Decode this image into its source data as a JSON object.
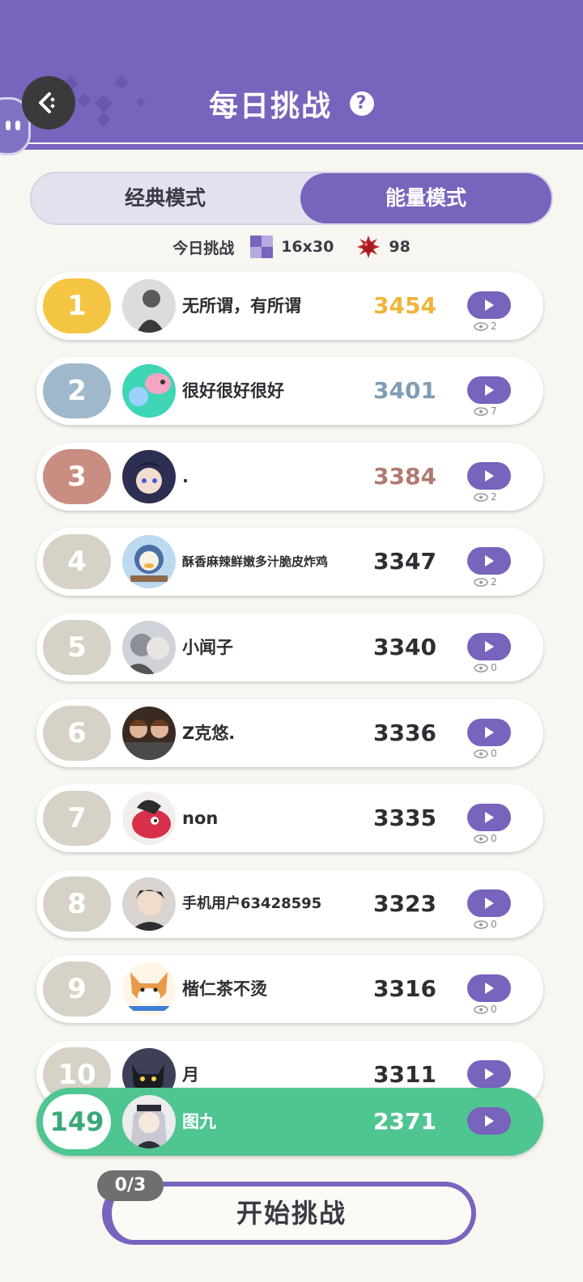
{
  "header": {
    "title": "每日挑战",
    "back_icon": "back-arrow-icon",
    "help_icon": "question-icon"
  },
  "modes": {
    "classic": "经典模式",
    "energy": "能量模式",
    "active": "energy"
  },
  "today": {
    "label": "今日挑战",
    "size": "16x30",
    "mines": "98"
  },
  "leaderboard": [
    {
      "rank": "1",
      "name": "无所谓，有所谓",
      "score": "3454",
      "views": "2"
    },
    {
      "rank": "2",
      "name": "很好很好很好",
      "score": "3401",
      "views": "7"
    },
    {
      "rank": "3",
      "name": ".",
      "score": "3384",
      "views": "2"
    },
    {
      "rank": "4",
      "name": "酥香麻辣鲜嫩多汁脆皮炸鸡",
      "score": "3347",
      "views": "2"
    },
    {
      "rank": "5",
      "name": "小闻子",
      "score": "3340",
      "views": "0"
    },
    {
      "rank": "6",
      "name": "Z克悠.",
      "score": "3336",
      "views": "0"
    },
    {
      "rank": "7",
      "name": "non",
      "score": "3335",
      "views": "0"
    },
    {
      "rank": "8",
      "name": "手机用户63428595",
      "score": "3323",
      "views": "0"
    },
    {
      "rank": "9",
      "name": "楷仁茶不烫",
      "score": "3316",
      "views": "0"
    },
    {
      "rank": "10",
      "name": "月",
      "score": "3311",
      "views": ""
    }
  ],
  "my_rank": {
    "rank": "149",
    "name": "图九",
    "score": "2371"
  },
  "start": {
    "counter": "0/3",
    "label": "开始挑战"
  },
  "colors": {
    "brand": "#7863bd",
    "gold": "#f4c542",
    "silver": "#9fb8cc",
    "bronze": "#c98d82",
    "me": "#4fc592"
  }
}
